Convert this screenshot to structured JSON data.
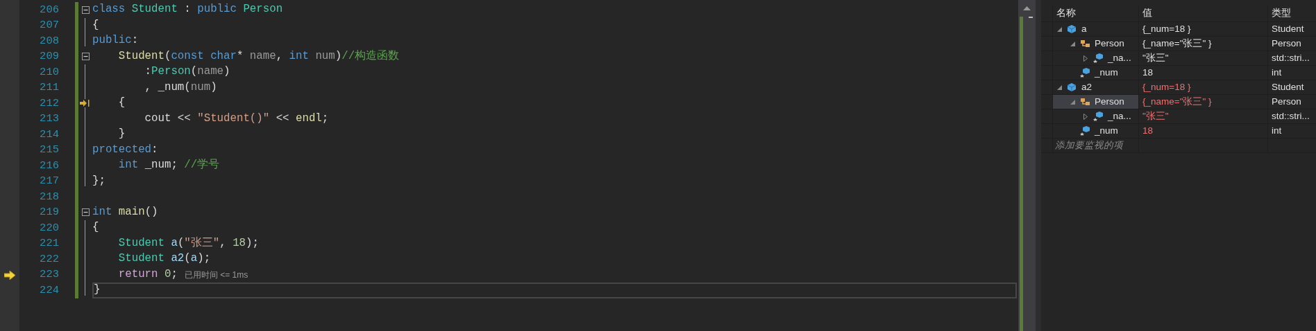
{
  "editor": {
    "lines": [
      {
        "number": "206",
        "fold": true,
        "current": false,
        "return_point": false,
        "highlighted": false,
        "tokens": [
          {
            "text": "class ",
            "kind": "kw"
          },
          {
            "text": "Student",
            "kind": "type"
          },
          {
            "text": " : ",
            "kind": "plain"
          },
          {
            "text": "public ",
            "kind": "kw"
          },
          {
            "text": "Person",
            "kind": "type"
          }
        ]
      },
      {
        "number": "207",
        "fold": false,
        "current": false,
        "return_point": false,
        "highlighted": false,
        "tokens": [
          {
            "text": "{",
            "kind": "plain"
          }
        ]
      },
      {
        "number": "208",
        "fold": false,
        "current": false,
        "return_point": false,
        "highlighted": false,
        "tokens": [
          {
            "text": "public",
            "kind": "kw"
          },
          {
            "text": ":",
            "kind": "plain"
          }
        ]
      },
      {
        "number": "209",
        "fold": true,
        "current": false,
        "return_point": false,
        "highlighted": false,
        "tokens": [
          {
            "text": "    Student",
            "kind": "fn"
          },
          {
            "text": "(",
            "kind": "plain"
          },
          {
            "text": "const ",
            "kind": "kw"
          },
          {
            "text": "char",
            "kind": "kw"
          },
          {
            "text": "* ",
            "kind": "plain"
          },
          {
            "text": "name",
            "kind": "param"
          },
          {
            "text": ", ",
            "kind": "plain"
          },
          {
            "text": "int ",
            "kind": "kw"
          },
          {
            "text": "num",
            "kind": "param"
          },
          {
            "text": ")",
            "kind": "plain"
          },
          {
            "text": "//构造函数",
            "kind": "cmt"
          }
        ]
      },
      {
        "number": "210",
        "fold": false,
        "current": false,
        "return_point": false,
        "highlighted": false,
        "tokens": [
          {
            "text": "        :",
            "kind": "plain"
          },
          {
            "text": "Person",
            "kind": "type"
          },
          {
            "text": "(",
            "kind": "plain"
          },
          {
            "text": "name",
            "kind": "param"
          },
          {
            "text": ")",
            "kind": "plain"
          }
        ]
      },
      {
        "number": "211",
        "fold": false,
        "current": false,
        "return_point": false,
        "highlighted": false,
        "tokens": [
          {
            "text": "        , _num(",
            "kind": "plain"
          },
          {
            "text": "num",
            "kind": "param"
          },
          {
            "text": ")",
            "kind": "plain"
          }
        ]
      },
      {
        "number": "212",
        "fold": false,
        "current": false,
        "return_point": true,
        "highlighted": false,
        "tokens": [
          {
            "text": "    {",
            "kind": "plain"
          }
        ]
      },
      {
        "number": "213",
        "fold": false,
        "current": false,
        "return_point": false,
        "highlighted": false,
        "tokens": [
          {
            "text": "        cout << ",
            "kind": "plain"
          },
          {
            "text": "\"Student()\"",
            "kind": "str"
          },
          {
            "text": " << ",
            "kind": "plain"
          },
          {
            "text": "endl",
            "kind": "fn"
          },
          {
            "text": ";",
            "kind": "plain"
          }
        ]
      },
      {
        "number": "214",
        "fold": false,
        "current": false,
        "return_point": false,
        "highlighted": false,
        "tokens": [
          {
            "text": "    }",
            "kind": "plain"
          }
        ]
      },
      {
        "number": "215",
        "fold": false,
        "current": false,
        "return_point": false,
        "highlighted": false,
        "tokens": [
          {
            "text": "protected",
            "kind": "kw"
          },
          {
            "text": ":",
            "kind": "plain"
          }
        ]
      },
      {
        "number": "216",
        "fold": false,
        "current": false,
        "return_point": false,
        "highlighted": false,
        "tokens": [
          {
            "text": "    int ",
            "kind": "kw"
          },
          {
            "text": "_num; ",
            "kind": "plain"
          },
          {
            "text": "//学号",
            "kind": "cmt"
          }
        ]
      },
      {
        "number": "217",
        "fold": false,
        "current": false,
        "return_point": false,
        "highlighted": false,
        "tokens": [
          {
            "text": "};",
            "kind": "plain"
          }
        ]
      },
      {
        "number": "218",
        "fold": false,
        "current": false,
        "return_point": false,
        "highlighted": false
      },
      {
        "number": "219",
        "fold": true,
        "current": false,
        "return_point": false,
        "highlighted": false,
        "tokens": [
          {
            "text": "int ",
            "kind": "kw"
          },
          {
            "text": "main",
            "kind": "fn"
          },
          {
            "text": "()",
            "kind": "plain"
          }
        ]
      },
      {
        "number": "220",
        "fold": false,
        "current": false,
        "return_point": false,
        "highlighted": false,
        "tokens": [
          {
            "text": "{",
            "kind": "plain"
          }
        ]
      },
      {
        "number": "221",
        "fold": false,
        "current": false,
        "return_point": false,
        "highlighted": false,
        "tokens": [
          {
            "text": "    Student ",
            "kind": "type"
          },
          {
            "text": "a",
            "kind": "local"
          },
          {
            "text": "(",
            "kind": "plain"
          },
          {
            "text": "\"张三\"",
            "kind": "str"
          },
          {
            "text": ", ",
            "kind": "plain"
          },
          {
            "text": "18",
            "kind": "num"
          },
          {
            "text": ");",
            "kind": "plain"
          }
        ]
      },
      {
        "number": "222",
        "fold": false,
        "current": false,
        "return_point": false,
        "highlighted": false,
        "tokens": [
          {
            "text": "    Student ",
            "kind": "type"
          },
          {
            "text": "a2",
            "kind": "local"
          },
          {
            "text": "(",
            "kind": "plain"
          },
          {
            "text": "a",
            "kind": "local"
          },
          {
            "text": ");",
            "kind": "plain"
          }
        ]
      },
      {
        "number": "223",
        "fold": false,
        "current": true,
        "return_point": false,
        "highlighted": false,
        "hint": "已用时间 <= 1ms",
        "tokens": [
          {
            "text": "    return ",
            "kind": "ctl"
          },
          {
            "text": "0",
            "kind": "num"
          },
          {
            "text": ";",
            "kind": "plain"
          }
        ]
      },
      {
        "number": "224",
        "fold": false,
        "current": false,
        "return_point": false,
        "highlighted": true,
        "tokens": [
          {
            "text": "}",
            "kind": "plain"
          }
        ]
      }
    ]
  },
  "watch": {
    "columns": [
      "名称",
      "值",
      "类型"
    ],
    "rows": [
      {
        "name": "a",
        "value": "{_num=18 }",
        "type": "Student",
        "kind": "object",
        "expanded": true,
        "changed": false,
        "selected": false,
        "children": [
          {
            "name": "Person",
            "value": "{_name=\"张三\" }",
            "type": "Person",
            "kind": "base",
            "expanded": true,
            "changed": false,
            "selected": false,
            "children": [
              {
                "name": "_na...",
                "value": "\"张三\"",
                "type": "std::stri...",
                "kind": "field",
                "expanded": false,
                "changed": false,
                "selected": false
              }
            ]
          },
          {
            "name": "_num",
            "value": "18",
            "type": "int",
            "kind": "field",
            "changed": false,
            "selected": false
          }
        ]
      },
      {
        "name": "a2",
        "value": "{_num=18 }",
        "type": "Student",
        "kind": "object",
        "expanded": true,
        "changed": true,
        "selected": false,
        "children": [
          {
            "name": "Person",
            "value": "{_name=\"张三\" }",
            "type": "Person",
            "kind": "base",
            "expanded": true,
            "changed": true,
            "selected": true,
            "children": [
              {
                "name": "_na...",
                "value": "\"张三\"",
                "type": "std::stri...",
                "kind": "field",
                "expanded": false,
                "changed": true,
                "selected": false
              }
            ]
          },
          {
            "name": "_num",
            "value": "18",
            "type": "int",
            "kind": "field",
            "changed": true,
            "selected": false
          }
        ]
      }
    ],
    "placeholder": "添加要监视的项"
  }
}
